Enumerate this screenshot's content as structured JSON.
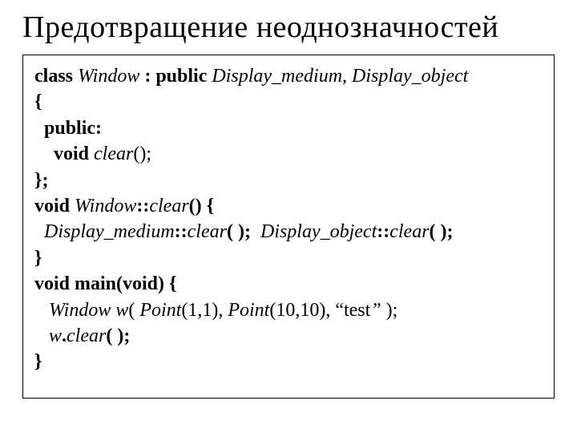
{
  "title": "Предотвращение неоднозначностей",
  "code": {
    "l1": {
      "a": "class ",
      "b": "Window ",
      "c": ": public ",
      "d": "Display_medium, Display_object"
    },
    "l2": {
      "a": "{"
    },
    "l3": {
      "a": "  public:"
    },
    "l4": {
      "a": "    void ",
      "b": "clear",
      "c": "();"
    },
    "l5": {
      "a": "};"
    },
    "l6": {
      "a": "void ",
      "b": "Window",
      "c": "::",
      "d": "clear",
      "e": "() {"
    },
    "l7": {
      "a": "  Display_medium",
      "b": "::",
      "c": "clear",
      "d": "( );  ",
      "e": "Display_object",
      "f": "::",
      "g": "clear",
      "h": "( );"
    },
    "l8": {
      "a": "}"
    },
    "l9": {
      "a": "void main(void) {"
    },
    "l10": {
      "a": "   Window w",
      "b": "( ",
      "c": "Point",
      "d": "(1,1)",
      "e": ", Point",
      "f": "(10,10), ",
      "g": "“",
      "h": "test",
      "i": "” ",
      "j": ");"
    },
    "l11": {
      "a": "   w",
      "b": ".",
      "c": "clear",
      "d": "( );"
    },
    "l12": {
      "a": "}"
    }
  }
}
